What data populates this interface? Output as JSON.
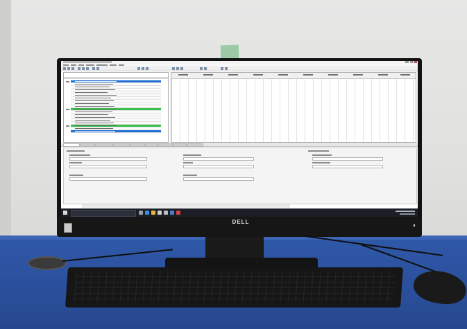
{
  "scene": {
    "monitor_brand": "DELL"
  },
  "colors": {
    "wall": "#e3e3e1",
    "desk": "#2c52a0",
    "bezel": "#121212",
    "row_highlight": "#37c04a",
    "row_selected": "#1f6fd6",
    "taskbar": "#1b1e26"
  },
  "icons": [
    "start-icon",
    "search-icon",
    "edge-icon",
    "folder-icon",
    "store-icon",
    "mail-icon",
    "app-icon"
  ]
}
